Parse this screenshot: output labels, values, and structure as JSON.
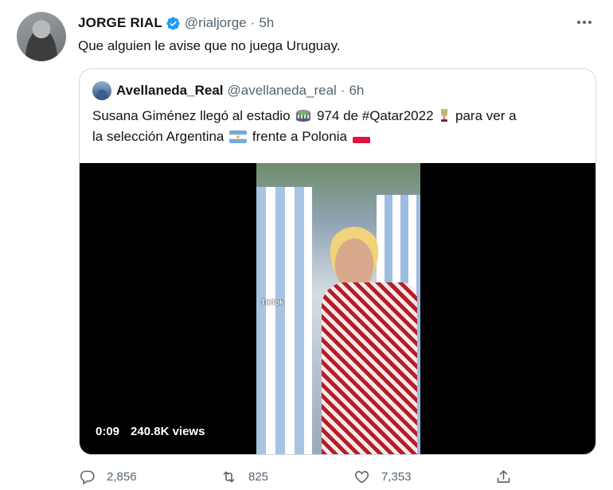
{
  "tweet": {
    "author": {
      "name": "JORGE RIAL",
      "handle": "@rialjorge",
      "time": "5h"
    },
    "separator": "·",
    "text": "Que alguien le avise que no juega Uruguay."
  },
  "quote": {
    "author": {
      "name": "Avellaneda_Real",
      "handle": "@avellaneda_real",
      "time": "6h"
    },
    "separator": "·",
    "text_line1_a": "Susana Giménez llegó al estadio",
    "text_line1_b": "974 de #Qatar2022",
    "text_line1_c": "para ver a",
    "text_line2_a": "la selección Argentina",
    "text_line2_b": "frente a Polonia",
    "emojis": [
      "stadium",
      "trophy",
      "argentina-flag",
      "poland-flag"
    ],
    "video": {
      "duration": "0:09",
      "views": "240.8K views",
      "watermark": "TikTok"
    }
  },
  "actions": {
    "replies": "2,856",
    "retweets": "825",
    "likes": "7,353"
  },
  "colors": {
    "verified": "#1d9bf0",
    "muted": "#536471",
    "border": "#cfd9de",
    "text": "#0f1419"
  },
  "icons": [
    "verified-badge-icon",
    "more-icon",
    "reply-icon",
    "retweet-icon",
    "like-icon",
    "share-icon"
  ]
}
